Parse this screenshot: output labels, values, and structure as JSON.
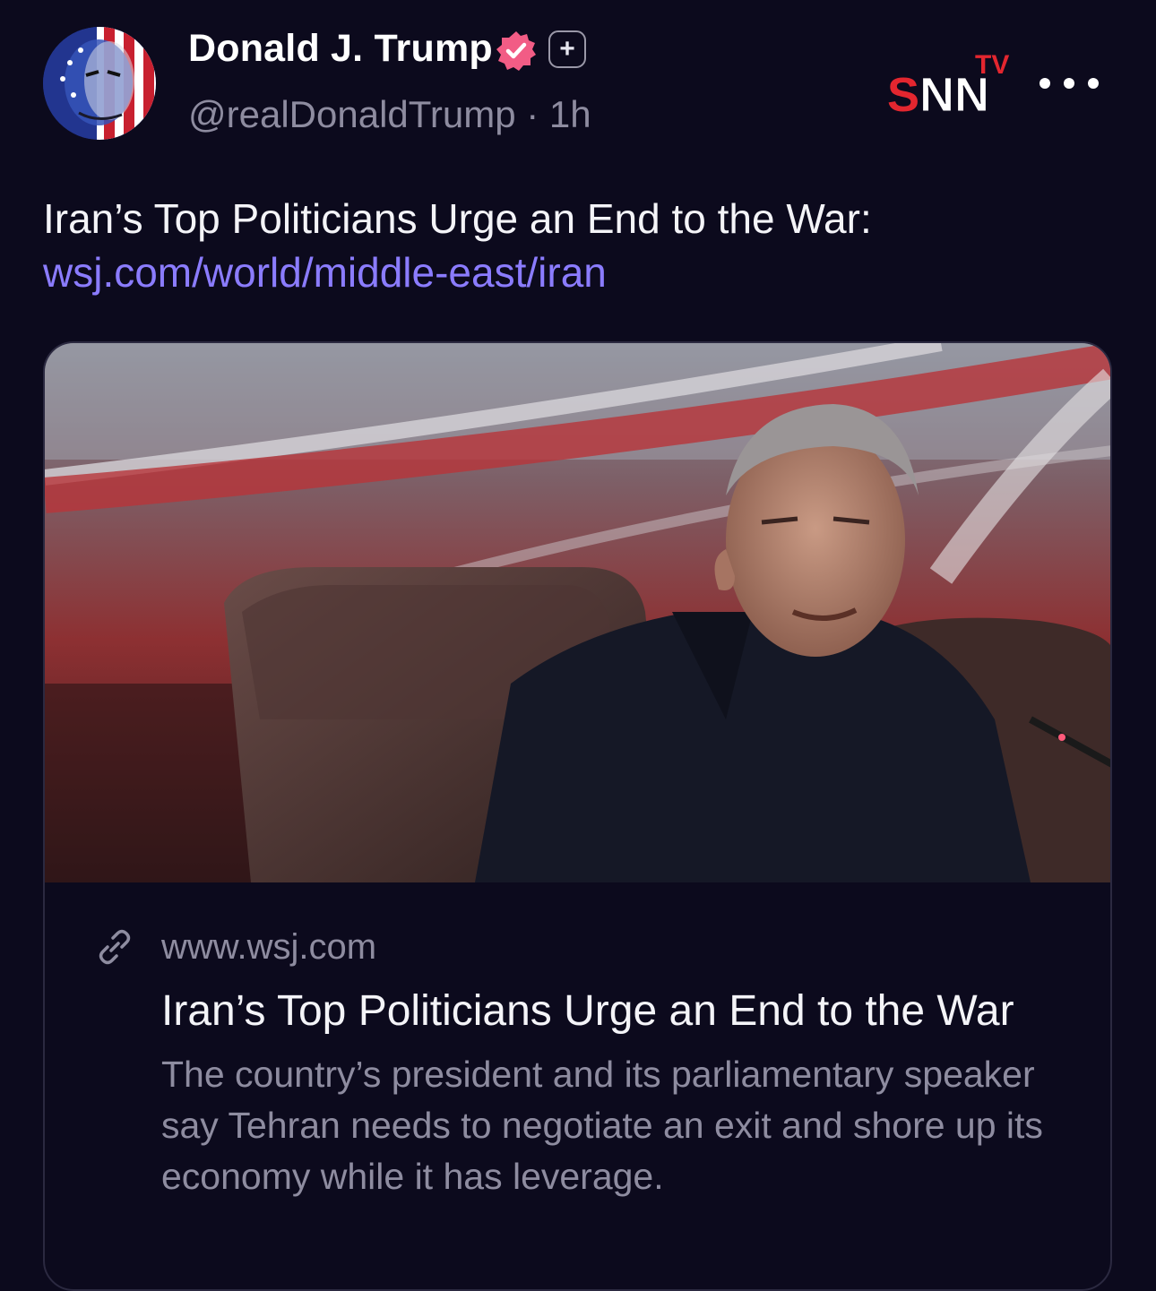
{
  "post": {
    "author_name": "Donald J. Trump",
    "handle": "@realDonaldTrump",
    "separator": "·",
    "time_ago": "1h",
    "text": "Iran’s Top Politicians Urge an End to the War:",
    "link": "wsj.com/world/middle-east/iran",
    "verified_icon": "verified-badge-icon",
    "plus_label": "+"
  },
  "watermark": {
    "logo_text": "SNN",
    "logo_superscript": "TV"
  },
  "card": {
    "domain": "www.wsj.com",
    "title": "Iran’s Top Politicians Urge an End to the War",
    "description": "The country’s president and its parliamentary speaker say Tehran needs to negotiate an exit and shore up its economy while it has leverage.",
    "link_icon": "link-icon"
  },
  "colors": {
    "background": "#0c0a1d",
    "link": "#8b7cff",
    "secondary_text": "#8e8ca0",
    "verified": "#f25c85"
  }
}
